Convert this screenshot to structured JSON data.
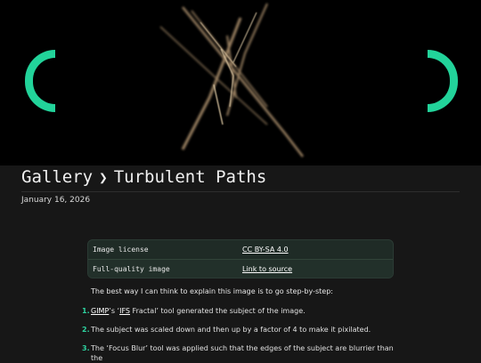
{
  "header": {
    "breadcrumb_root": "Gallery",
    "separator": "❯",
    "page_title": "Turbulent Paths",
    "date": "January 16, 2026"
  },
  "info_table": {
    "rows": [
      {
        "key": "Image license",
        "value": "CC BY-SA 4.0"
      },
      {
        "key": "Full-quality image",
        "value": "Link to source"
      }
    ]
  },
  "body": {
    "intro": "The best way I can think to explain this image is to go step-by-step:",
    "steps": [
      {
        "num": "1.",
        "link1": "GIMP",
        "mid": "’s ‘",
        "link2": "IFS",
        "rest": " Fractal’ tool generated the subject of the image."
      },
      {
        "num": "2.",
        "text": "The subject was scaled down and then up by a factor of 4 to make it pixilated."
      },
      {
        "num": "3.",
        "text": "The ‘Focus Blur’ tool was applied such that the edges of the subject are blurrier than the"
      }
    ]
  },
  "colors": {
    "accent": "#22d39a",
    "background": "#171717",
    "hero_background": "#000000",
    "table_background": "#1f2b26"
  }
}
